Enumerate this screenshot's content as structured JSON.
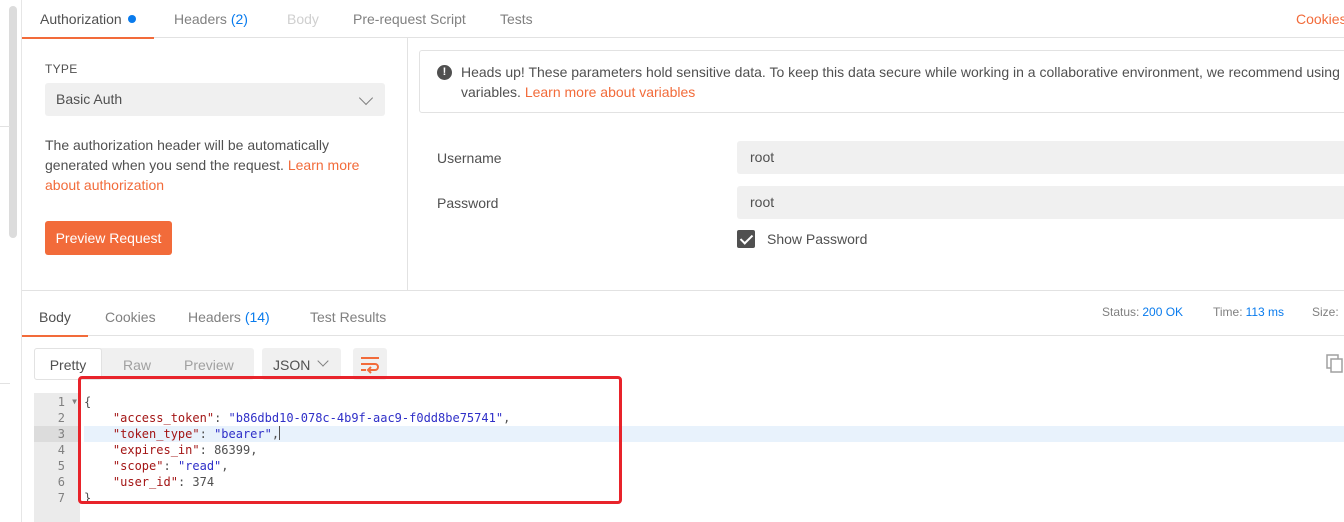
{
  "request_tabs": {
    "authorization": "Authorization",
    "headers": "Headers",
    "headers_count": "(2)",
    "body": "Body",
    "pre_request": "Pre-request Script",
    "tests": "Tests",
    "cookies": "Cookies"
  },
  "auth": {
    "type_label": "TYPE",
    "type_value": "Basic Auth",
    "desc_prefix": "The authorization header will be automatically generated when you send the request. ",
    "desc_link": "Learn more about authorization",
    "preview_button": "Preview Request",
    "warning_text": "Heads up! These parameters hold sensitive data. To keep this data secure while working in a collaborative environment, we recommend using",
    "warning_text2": "variables. ",
    "warning_link": "Learn more about variables",
    "username_label": "Username",
    "username_value": "root",
    "password_label": "Password",
    "password_value": "root",
    "show_password": "Show Password"
  },
  "response_tabs": {
    "body": "Body",
    "cookies": "Cookies",
    "headers": "Headers",
    "headers_count": "(14)",
    "test_results": "Test Results",
    "status_label": "Status:",
    "status_value": "200 OK",
    "time_label": "Time:",
    "time_value": "113 ms",
    "size_label": "Size:"
  },
  "response_toolbar": {
    "pretty": "Pretty",
    "raw": "Raw",
    "preview": "Preview",
    "lang": "JSON"
  },
  "code": {
    "line_numbers": [
      "1",
      "2",
      "3",
      "4",
      "5",
      "6",
      "7"
    ],
    "open_brace": "{",
    "close_brace": "}",
    "access_token_key": "\"access_token\"",
    "access_token_val": "\"b86dbd10-078c-4b9f-aac9-f0dd8be75741\"",
    "token_type_key": "\"token_type\"",
    "token_type_val": "\"bearer\"",
    "expires_in_key": "\"expires_in\"",
    "expires_in_val": "86399",
    "scope_key": "\"scope\"",
    "scope_val": "\"read\"",
    "user_id_key": "\"user_id\"",
    "user_id_val": "374"
  },
  "colors": {
    "accent": "#f26b3a",
    "link_blue": "#097bed",
    "annotation_red": "#e8232a"
  }
}
